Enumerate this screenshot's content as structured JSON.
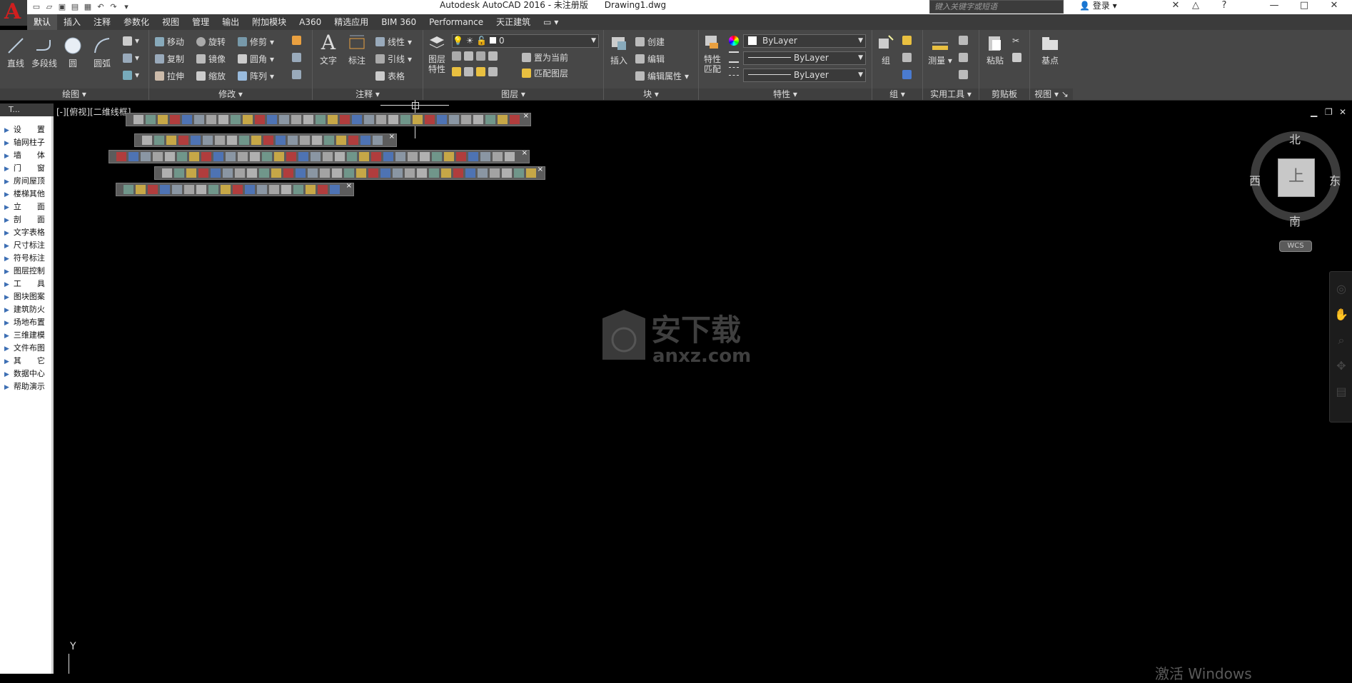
{
  "title_bar": {
    "text": "Autodesk AutoCAD 2016 - 未注册版      Drawing1.dwg",
    "search_placeholder": "键入关键字或短语",
    "login_label": "登录"
  },
  "ribbon": {
    "tabs": [
      "默认",
      "插入",
      "注释",
      "参数化",
      "视图",
      "管理",
      "输出",
      "附加模块",
      "A360",
      "精选应用",
      "BIM 360",
      "Performance",
      "天正建筑"
    ],
    "active_tab": "默认",
    "draw": {
      "line": "直线",
      "polyline": "多段线",
      "circle": "圆",
      "arc": "圆弧",
      "label": "绘图"
    },
    "modify": {
      "move": "移动",
      "rotate": "旋转",
      "trim": "修剪",
      "copy": "复制",
      "mirror": "镜像",
      "fillet": "圆角",
      "stretch": "拉伸",
      "scale": "缩放",
      "array": "阵列",
      "label": "修改"
    },
    "annotation": {
      "text": "文字",
      "dimension": "标注",
      "linear": "线性",
      "leader": "引线",
      "table": "表格",
      "label": "注释"
    },
    "layers": {
      "properties": "图层\n特性",
      "current_layer": "0",
      "set_current": "置为当前",
      "match_layer": "匹配图层",
      "label": "图层"
    },
    "block": {
      "insert": "插入",
      "create": "创建",
      "edit": "编辑",
      "edit_attr": "编辑属性",
      "label": "块"
    },
    "properties": {
      "match": "特性\n匹配",
      "color": "ByLayer",
      "linetype": "ByLayer",
      "lineweight": "ByLayer",
      "label": "特性"
    },
    "groups": {
      "group": "组",
      "label": "组"
    },
    "utilities": {
      "measure": "测量",
      "label": "实用工具"
    },
    "clipboard": {
      "paste": "粘贴",
      "label": "剪贴板"
    },
    "view": {
      "base": "基点",
      "label": "视图"
    }
  },
  "palette": {
    "header": "T...",
    "items": [
      "设　　置",
      "轴网柱子",
      "墙　　体",
      "门　　窗",
      "房间屋顶",
      "楼梯其他",
      "立　　面",
      "剖　　面",
      "文字表格",
      "尺寸标注",
      "符号标注",
      "图层控制",
      "工　　具",
      "图块图案",
      "建筑防火",
      "场地布置",
      "三维建模",
      "文件布图",
      "其　　它",
      "数据中心",
      "帮助演示"
    ]
  },
  "viewport": {
    "label": "[-][俯视][二维线框]",
    "compass": {
      "north": "北",
      "south": "南",
      "east": "东",
      "west": "西"
    },
    "cube_face": "上",
    "wcs": "WCS",
    "ucs_axis": "Y"
  },
  "watermark": {
    "brand": "安下载",
    "url": "anxz.com"
  },
  "activation_text": "激活 Windows"
}
